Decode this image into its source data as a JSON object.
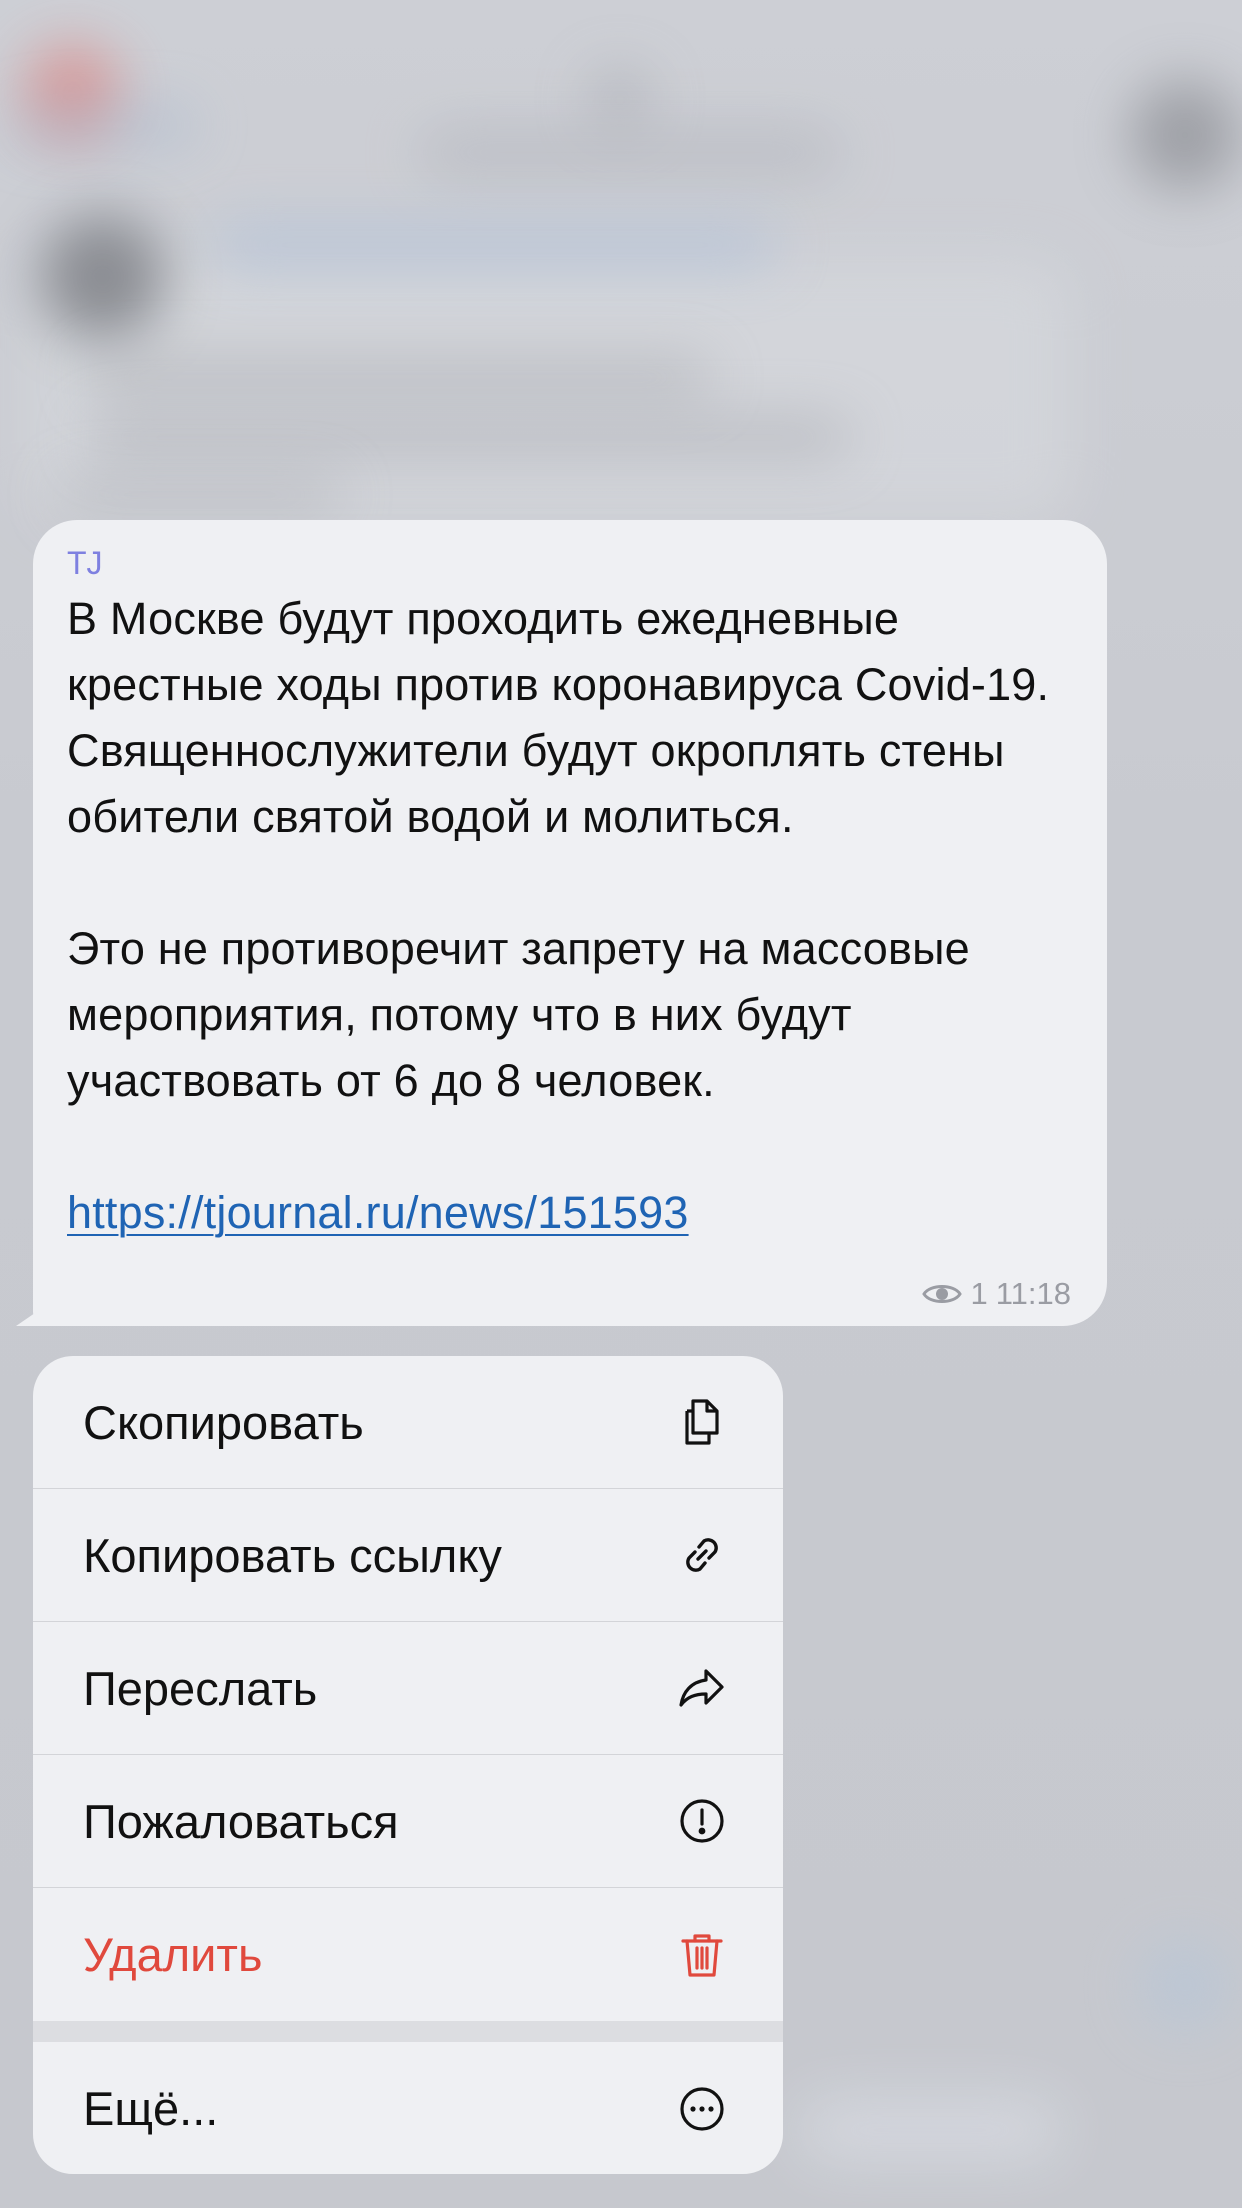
{
  "message": {
    "channel": "TJ",
    "paragraph1": "В Москве будут проходить ежедневные крестные ходы против коронавируса Covid-19. Священнослужители будут окроплять стены обители святой водой и молиться.",
    "paragraph2": "Это не противоречит запрету на массовые мероприятия, потому что в них будут участвовать от 6 до 8 человек.",
    "link": "https://tjournal.ru/news/151593",
    "views": "1",
    "time": "11:18"
  },
  "menu": {
    "items": [
      {
        "label": "Скопировать",
        "icon": "copy-icon"
      },
      {
        "label": "Копировать ссылку",
        "icon": "link-icon"
      },
      {
        "label": "Переслать",
        "icon": "forward-icon"
      },
      {
        "label": "Пожаловаться",
        "icon": "report-icon"
      },
      {
        "label": "Удалить",
        "icon": "trash-icon",
        "color": "#e0493d"
      },
      {
        "label": "Ещё...",
        "icon": "more-icon"
      }
    ]
  },
  "colors": {
    "accent_link": "#1f64b4",
    "channel_name": "#7e80e0",
    "danger": "#e0493d"
  }
}
